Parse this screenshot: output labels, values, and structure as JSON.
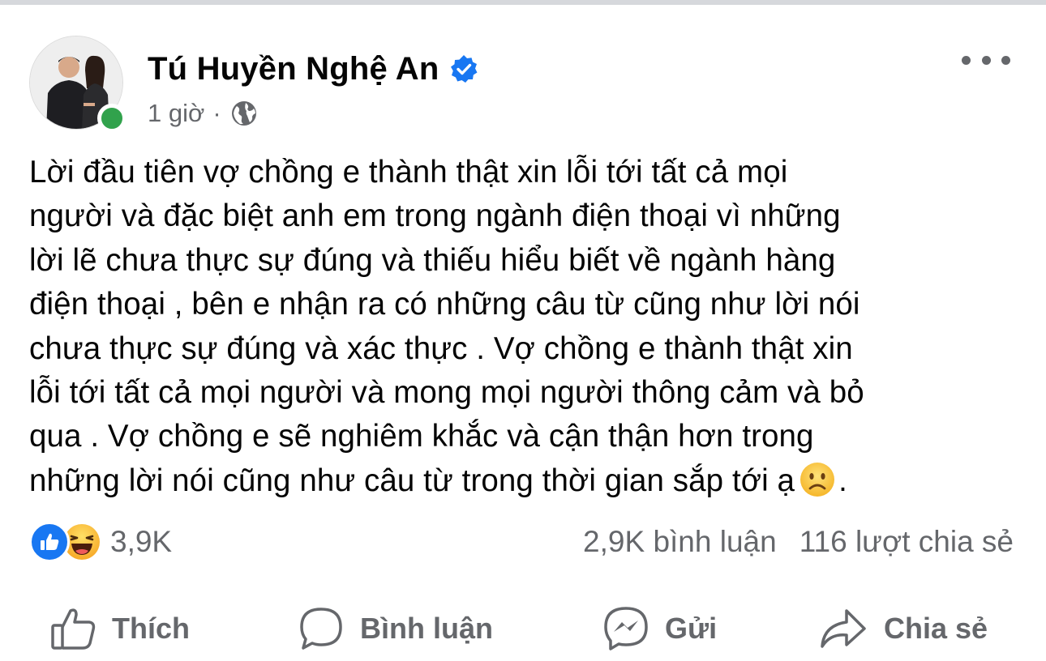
{
  "post": {
    "author_name": "Tú Huyền Nghệ An",
    "timestamp": "1 giờ",
    "separator": "·",
    "audience_icon": "globe-icon",
    "verified_icon": "verified-badge-icon",
    "more_icon": "more-options-icon",
    "body_text": "Lời đầu tiên vợ chồng e thành thật xin lỗi tới tất cả mọi\nngười và đặc biệt anh em trong ngành điện thoại vì những\nlời lẽ chưa thực sự đúng và thiếu hiểu biết về ngành hàng\nđiện thoại , bên e nhận ra có những câu từ cũng như lời nói\nchưa thực sự đúng và xác thực . Vợ chồng e thành thật xin\nlỗi tới tất cả mọi người và mong mọi người thông cảm và bỏ\nqua . Vợ chồng e sẽ nghiêm khắc và cận thận hơn trong\nnhững lời nói cũng như câu từ trong thời gian sắp tới ạ",
    "body_trailing": "."
  },
  "stats": {
    "reaction_icons": [
      "like-reaction-icon",
      "haha-reaction-icon"
    ],
    "reaction_count": "3,9K",
    "comments": "2,9K bình luận",
    "shares": "116 lượt chia sẻ"
  },
  "actions": {
    "like_label": "Thích",
    "comment_label": "Bình luận",
    "send_label": "Gửi",
    "share_label": "Chia sẻ"
  },
  "colors": {
    "accent": "#1877f2",
    "secondary_text": "#65676b",
    "online": "#31a24c",
    "text": "#050505"
  }
}
